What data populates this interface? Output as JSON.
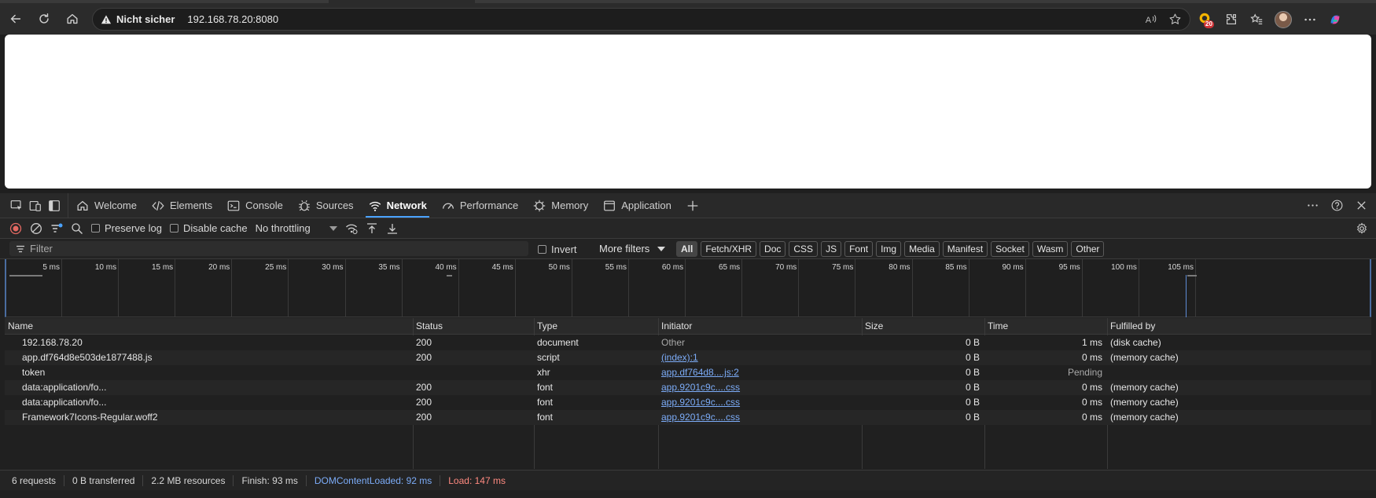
{
  "browser": {
    "security_label": "Nicht sicher",
    "url": "192.168.78.20:8080",
    "extension_badge": "20"
  },
  "devtools": {
    "tabs": [
      {
        "label": "Welcome",
        "icon": "home-icon"
      },
      {
        "label": "Elements",
        "icon": "code-icon"
      },
      {
        "label": "Console",
        "icon": "console-icon"
      },
      {
        "label": "Sources",
        "icon": "bug-icon"
      },
      {
        "label": "Network",
        "icon": "wifi-icon",
        "active": true
      },
      {
        "label": "Performance",
        "icon": "gauge-icon"
      },
      {
        "label": "Memory",
        "icon": "memory-icon"
      },
      {
        "label": "Application",
        "icon": "window-icon"
      }
    ],
    "toolbar": {
      "preserve_log": "Preserve log",
      "disable_cache": "Disable cache",
      "throttling": "No throttling"
    },
    "filterbar": {
      "filter_placeholder": "Filter",
      "invert": "Invert",
      "more_filters": "More filters",
      "types": [
        "All",
        "Fetch/XHR",
        "Doc",
        "CSS",
        "JS",
        "Font",
        "Img",
        "Media",
        "Manifest",
        "Socket",
        "Wasm",
        "Other"
      ]
    },
    "timeline": {
      "ticks": [
        "5 ms",
        "10 ms",
        "15 ms",
        "20 ms",
        "25 ms",
        "30 ms",
        "35 ms",
        "40 ms",
        "45 ms",
        "50 ms",
        "55 ms",
        "60 ms",
        "65 ms",
        "70 ms",
        "75 ms",
        "80 ms",
        "85 ms",
        "90 ms",
        "95 ms",
        "100 ms",
        "105 ms"
      ]
    },
    "table": {
      "columns": [
        "Name",
        "Status",
        "Type",
        "Initiator",
        "Size",
        "Time",
        "Fulfilled by"
      ],
      "rows": [
        {
          "name": "192.168.78.20",
          "status": "200",
          "type": "document",
          "initiator": "Other",
          "initiator_link": false,
          "size": "0 B",
          "time": "1 ms",
          "fulfilled": "(disk cache)"
        },
        {
          "name": "app.df764d8e503de1877488.js",
          "status": "200",
          "type": "script",
          "initiator": "(index):1",
          "initiator_link": true,
          "size": "0 B",
          "time": "0 ms",
          "fulfilled": "(memory cache)"
        },
        {
          "name": "token",
          "status": "",
          "type": "xhr",
          "initiator": "app.df764d8....js:2",
          "initiator_link": true,
          "size": "0 B",
          "time": "Pending",
          "fulfilled": ""
        },
        {
          "name": "data:application/fo...",
          "status": "200",
          "type": "font",
          "initiator": "app.9201c9c....css",
          "initiator_link": true,
          "size": "0 B",
          "time": "0 ms",
          "fulfilled": "(memory cache)"
        },
        {
          "name": "data:application/fo...",
          "status": "200",
          "type": "font",
          "initiator": "app.9201c9c....css",
          "initiator_link": true,
          "size": "0 B",
          "time": "0 ms",
          "fulfilled": "(memory cache)"
        },
        {
          "name": "Framework7Icons-Regular.woff2",
          "status": "200",
          "type": "font",
          "initiator": "app.9201c9c....css",
          "initiator_link": true,
          "size": "0 B",
          "time": "0 ms",
          "fulfilled": "(memory cache)"
        }
      ]
    },
    "status": {
      "requests": "6 requests",
      "transferred": "0 B transferred",
      "resources": "2.2 MB resources",
      "finish": "Finish: 93 ms",
      "dcl": "DOMContentLoaded: 92 ms",
      "load": "Load: 147 ms"
    }
  },
  "colors": {
    "accent": "#4aa3ff",
    "link": "#7cacf8",
    "load": "#ff8a80"
  }
}
